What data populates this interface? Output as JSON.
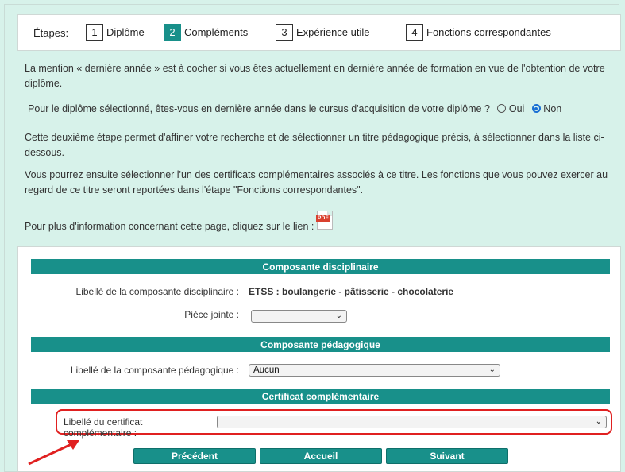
{
  "steps": {
    "label": "Étapes:",
    "items": [
      {
        "num": "1",
        "name": "Diplôme"
      },
      {
        "num": "2",
        "name": "Compléments"
      },
      {
        "num": "3",
        "name": "Expérience utile"
      },
      {
        "num": "4",
        "name": "Fonctions correspondantes"
      }
    ]
  },
  "intro": {
    "mention_line1": "La mention « dernière année » est à cocher si vous êtes actuellement en dernière année de formation en vue de l'obtention de votre",
    "mention_line2": "diplôme.",
    "question": "Pour le diplôme sélectionné, êtes-vous en dernière année dans le cursus d'acquisition de votre diplôme ?",
    "option_yes": "Oui",
    "option_no": "Non",
    "selected": "Non",
    "step2_line1": "Cette deuxième étape permet d'affiner votre recherche et de sélectionner un titre pédagogique précis, à sélectionner dans la liste ci-",
    "step2_line2": "dessous.",
    "cert_line1": "Vous pourrez ensuite sélectionner l'un des certificats complémentaires associés à ce titre. Les fonctions que vous pouvez exercer au",
    "cert_line2": "regard de ce titre seront reportées dans l'étape \"Fonctions correspondantes\".",
    "info": "Pour plus d'information concernant cette page, cliquez sur le lien :",
    "pdf_label": "PDF"
  },
  "discipline": {
    "header": "Composante disciplinaire",
    "label": "Libellé de la composante disciplinaire :",
    "value": "ETSS : boulangerie - pâtisserie - chocolaterie",
    "attachment_label": "Pièce jointe :",
    "attachment_value": ""
  },
  "pedagogic": {
    "header": "Composante pédagogique",
    "label": "Libellé de la composante pédagogique :",
    "value": "Aucun"
  },
  "certificate": {
    "header": "Certificat complémentaire",
    "label": "Libellé du certificat complémentaire :",
    "value": ""
  },
  "buttons": {
    "previous": "Précédent",
    "home": "Accueil",
    "next": "Suivant"
  },
  "colors": {
    "accent": "#18908a",
    "background": "#d7f2ea",
    "highlight": "#e02020"
  }
}
